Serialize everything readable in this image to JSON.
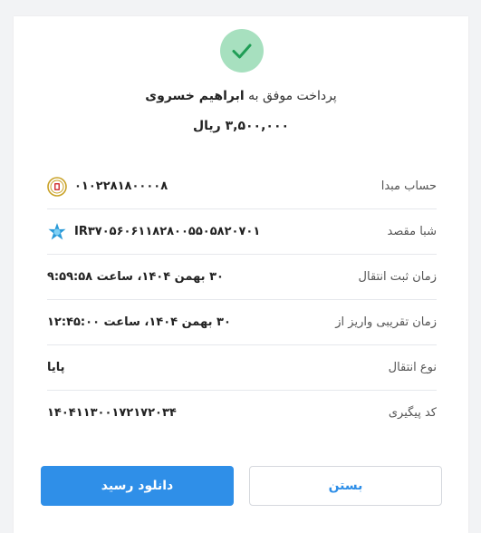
{
  "receipt": {
    "title_prefix": "پرداخت موفق به",
    "recipient_name": "ابراهیم خسروی",
    "amount": "۳,۵۰۰,۰۰۰ ریال",
    "rows": [
      {
        "label": "حساب مبدا",
        "value": "۰۱۰۲۲۸۱۸۰۰۰۰۸",
        "icon": "melli-bank-logo-icon"
      },
      {
        "label": "شبا مقصد",
        "value": "IR۳۷۰۵۶۰۶۱۱۸۲۸۰۰۵۵۰۵۸۲۰۷۰۱",
        "icon": "saman-bank-logo-icon"
      },
      {
        "label": "زمان ثبت انتقال",
        "value": "۳۰ بهمن ۱۴۰۴، ساعت ۹:۵۹:۵۸"
      },
      {
        "label": "زمان تقریبی واریز از",
        "value": "۳۰ بهمن ۱۴۰۴، ساعت ۱۲:۴۵:۰۰"
      },
      {
        "label": "نوع انتقال",
        "value": "پایا"
      },
      {
        "label": "کد پیگیری",
        "value": "۱۴۰۴۱۱۳۰۰۱۷۲۱۷۲۰۳۴"
      }
    ]
  },
  "buttons": {
    "download_label": "دانلود رسید",
    "close_label": "بستن"
  },
  "colors": {
    "accent": "#2f8fe8",
    "success_circle": "#a7e0bf",
    "success_check": "#1f9d55"
  }
}
